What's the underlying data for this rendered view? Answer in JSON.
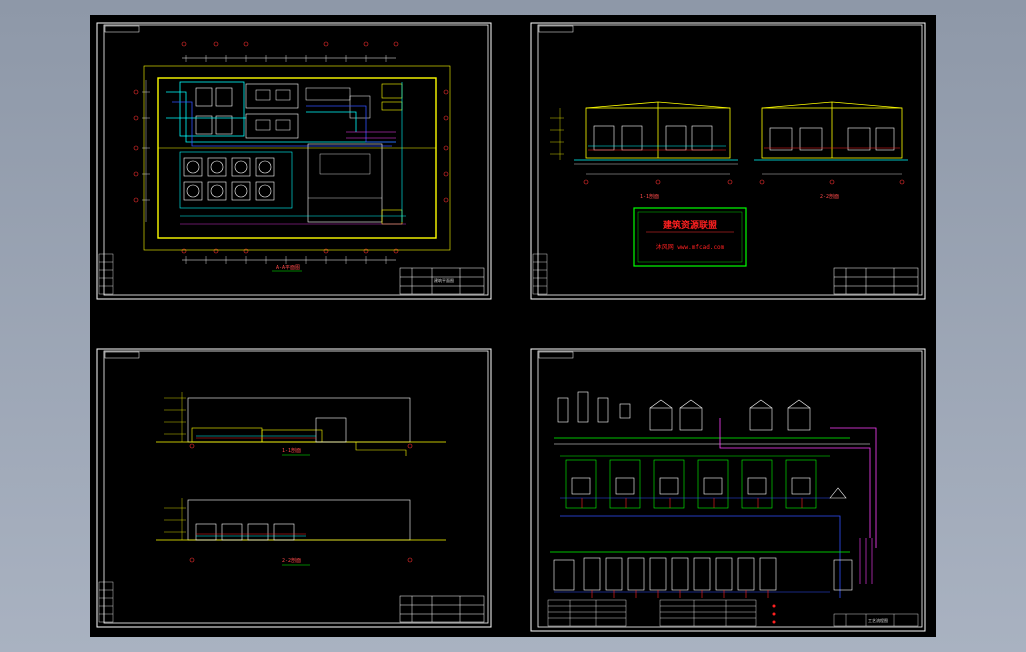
{
  "viewer": {
    "background_color": "#000000",
    "line_colors": {
      "frame": "#ffffff",
      "wall": "#ffff00",
      "cyan": "#00ffff",
      "green": "#00ff00",
      "red": "#ff2020",
      "magenta": "#ff40ff",
      "blue": "#3050ff",
      "white": "#ffffff"
    }
  },
  "sheets": [
    {
      "id": "plan",
      "title": "A-A平面图",
      "titleblock_note": "建筑平面图"
    },
    {
      "id": "sections",
      "title_left": "1-1剖面",
      "title_right": "2-2剖面",
      "watermark": {
        "line1": "建筑资源联盟",
        "line2": "沐风网 www.mfcad.com"
      }
    },
    {
      "id": "elevations",
      "title_top": "1-1剖面",
      "title_bottom": "2-2剖面"
    },
    {
      "id": "schematic",
      "titleblock_note": "工艺流程图"
    }
  ]
}
